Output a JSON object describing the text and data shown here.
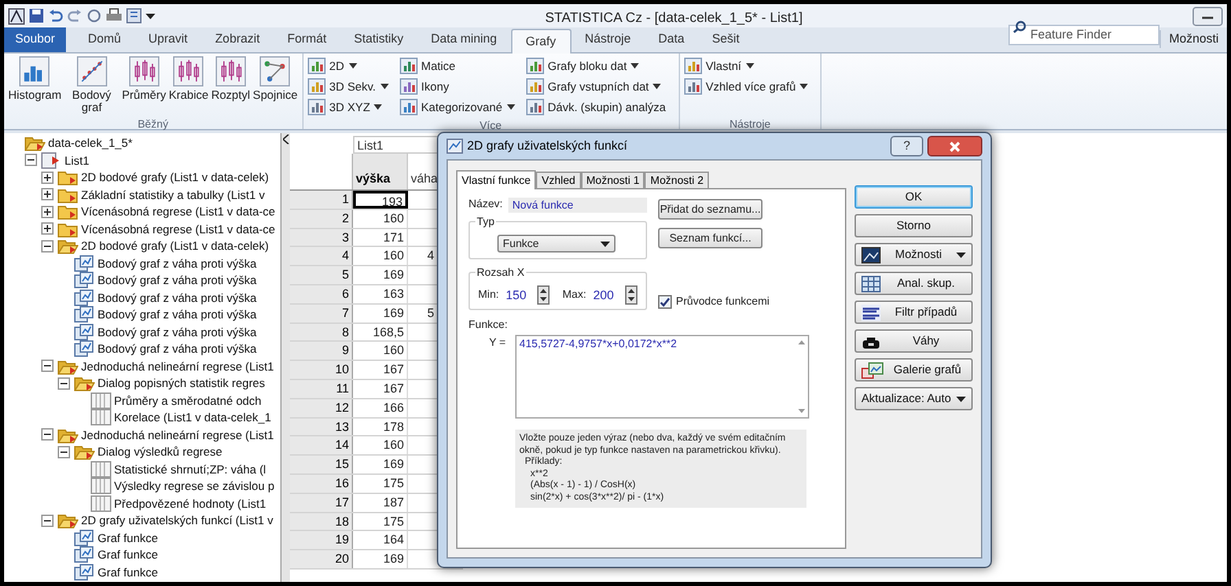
{
  "window": {
    "title": "STATISTICA Cz - [data-celek_1_5* - List1]"
  },
  "ribbon_tabs": [
    {
      "label": "Soubor",
      "kind": "file",
      "selected": false
    },
    {
      "label": "Domů",
      "kind": "tab",
      "selected": false
    },
    {
      "label": "Upravit",
      "kind": "tab",
      "selected": false
    },
    {
      "label": "Zobrazit",
      "kind": "tab",
      "selected": false
    },
    {
      "label": "Formát",
      "kind": "tab",
      "selected": false
    },
    {
      "label": "Statistiky",
      "kind": "tab",
      "selected": false
    },
    {
      "label": "Data mining",
      "kind": "tab",
      "selected": false
    },
    {
      "label": "Grafy",
      "kind": "tab",
      "selected": true
    },
    {
      "label": "Nástroje",
      "kind": "tab",
      "selected": false
    },
    {
      "label": "Data",
      "kind": "tab",
      "selected": false
    },
    {
      "label": "Sešit",
      "kind": "tab",
      "selected": false
    }
  ],
  "feature_finder": {
    "placeholder": "Feature Finder"
  },
  "options_label": "Možnosti",
  "ribbon_groups": [
    {
      "label": "Běžný",
      "kind": "large",
      "columns": [
        [
          {
            "label": "Histogram",
            "dropdown": false
          }
        ],
        [
          {
            "label": "Bodový graf",
            "dropdown": false
          }
        ],
        [
          {
            "label": "Průměry",
            "dropdown": false
          }
        ],
        [
          {
            "label": "Krabice",
            "dropdown": false
          }
        ],
        [
          {
            "label": "Rozptyl",
            "dropdown": false
          }
        ],
        [
          {
            "label": "Spojnice",
            "dropdown": false
          }
        ]
      ]
    },
    {
      "label": "Více",
      "kind": "small",
      "columns": [
        [
          {
            "label": "2D",
            "dropdown": true
          },
          {
            "label": "3D Sekv.",
            "dropdown": true
          },
          {
            "label": "3D XYZ",
            "dropdown": true
          }
        ],
        [
          {
            "label": "Matice",
            "dropdown": false
          },
          {
            "label": "Ikony",
            "dropdown": false
          },
          {
            "label": "Kategorizované",
            "dropdown": true
          }
        ],
        [
          {
            "label": "Grafy bloku dat",
            "dropdown": true
          },
          {
            "label": "Grafy vstupních dat",
            "dropdown": true
          },
          {
            "label": "Dávk. (skupin) analýza",
            "dropdown": false
          }
        ]
      ]
    },
    {
      "label": "Nástroje",
      "kind": "small",
      "columns": [
        [
          {
            "label": "Vlastní",
            "dropdown": true
          },
          {
            "label": "Vzhled více grafů",
            "dropdown": true
          }
        ]
      ]
    }
  ],
  "tree": [
    {
      "label": "data-celek_1_5*",
      "kind": "folder",
      "expanded": true,
      "children": [
        {
          "label": "List1",
          "kind": "sheet",
          "expanded": true,
          "children": [
            {
              "label": "2D bodové grafy (List1 v data-celek)",
              "kind": "folder",
              "expanded": false
            },
            {
              "label": "Základní statistiky a tabulky (List1 v",
              "kind": "folder",
              "expanded": false
            },
            {
              "label": "Vícenásobná regrese (List1 v data-ce",
              "kind": "folder",
              "expanded": false
            },
            {
              "label": "Vícenásobná regrese (List1 v data-ce",
              "kind": "folder",
              "expanded": false
            },
            {
              "label": "2D bodové grafy (List1 v data-celek)",
              "kind": "folder",
              "expanded": true,
              "children": [
                {
                  "label": "Bodový graf z váha proti výška",
                  "kind": "graph"
                },
                {
                  "label": "Bodový graf z váha proti výška",
                  "kind": "graph"
                },
                {
                  "label": "Bodový graf z váha proti výška",
                  "kind": "graph"
                },
                {
                  "label": "Bodový graf z váha proti výška",
                  "kind": "graph"
                },
                {
                  "label": "Bodový graf z váha proti výška",
                  "kind": "graph"
                },
                {
                  "label": "Bodový graf z váha proti výška",
                  "kind": "graph"
                }
              ]
            },
            {
              "label": "Jednoduchá nelineární regrese (List1",
              "kind": "folder",
              "expanded": true,
              "children": [
                {
                  "label": "Dialog popisných statistik regres",
                  "kind": "folder",
                  "expanded": true,
                  "children": [
                    {
                      "label": "Průměry a směrodatné odch",
                      "kind": "table"
                    },
                    {
                      "label": "Korelace (List1 v data-celek_1",
                      "kind": "table"
                    }
                  ]
                }
              ]
            },
            {
              "label": "Jednoduchá nelineární regrese (List1",
              "kind": "folder",
              "expanded": true,
              "children": [
                {
                  "label": "Dialog výsledků regrese",
                  "kind": "folder",
                  "expanded": true,
                  "children": [
                    {
                      "label": "Statistické shrnutí;ZP: váha (l",
                      "kind": "table"
                    },
                    {
                      "label": "Výsledky regrese se závislou p",
                      "kind": "table"
                    },
                    {
                      "label": "Předpovězené hodnoty (List1",
                      "kind": "table"
                    }
                  ]
                }
              ]
            },
            {
              "label": "2D grafy uživatelských funkcí (List1 v",
              "kind": "folder",
              "expanded": true,
              "children": [
                {
                  "label": "Graf funkce",
                  "kind": "graph"
                },
                {
                  "label": "Graf funkce",
                  "kind": "graph"
                },
                {
                  "label": "Graf funkce",
                  "kind": "graph"
                }
              ]
            }
          ]
        }
      ]
    }
  ],
  "sheet": {
    "title": "List1",
    "columns": [
      "výška",
      "váha"
    ],
    "rows": [
      {
        "header": "1",
        "cells": [
          "193",
          ""
        ],
        "selected": true
      },
      {
        "header": "2",
        "cells": [
          "160",
          ""
        ],
        "selected": false
      },
      {
        "header": "3",
        "cells": [
          "171",
          ""
        ],
        "selected": false
      },
      {
        "header": "4",
        "cells": [
          "160",
          "4"
        ],
        "selected": false
      },
      {
        "header": "5",
        "cells": [
          "169",
          ""
        ],
        "selected": false
      },
      {
        "header": "6",
        "cells": [
          "163",
          ""
        ],
        "selected": false
      },
      {
        "header": "7",
        "cells": [
          "169",
          "5"
        ],
        "selected": false
      },
      {
        "header": "8",
        "cells": [
          "168,5",
          ""
        ],
        "selected": false
      },
      {
        "header": "9",
        "cells": [
          "160",
          ""
        ],
        "selected": false
      },
      {
        "header": "10",
        "cells": [
          "167",
          ""
        ],
        "selected": false
      },
      {
        "header": "11",
        "cells": [
          "167",
          ""
        ],
        "selected": false
      },
      {
        "header": "12",
        "cells": [
          "166",
          ""
        ],
        "selected": false
      },
      {
        "header": "13",
        "cells": [
          "178",
          ""
        ],
        "selected": false
      },
      {
        "header": "14",
        "cells": [
          "160",
          ""
        ],
        "selected": false
      },
      {
        "header": "15",
        "cells": [
          "169",
          ""
        ],
        "selected": false
      },
      {
        "header": "16",
        "cells": [
          "175",
          ""
        ],
        "selected": false
      },
      {
        "header": "17",
        "cells": [
          "187",
          ""
        ],
        "selected": false
      },
      {
        "header": "18",
        "cells": [
          "175",
          ""
        ],
        "selected": false
      },
      {
        "header": "19",
        "cells": [
          "164",
          ""
        ],
        "selected": false
      },
      {
        "header": "20",
        "cells": [
          "169",
          ""
        ],
        "selected": false
      }
    ]
  },
  "dialog": {
    "title": "2D grafy uživatelských funkcí",
    "help_glyph": "?",
    "tabs": [
      {
        "label": "Vlastní funkce",
        "selected": true
      },
      {
        "label": "Vzhled",
        "selected": false
      },
      {
        "label": "Možnosti 1",
        "selected": false
      },
      {
        "label": "Možnosti 2",
        "selected": false
      }
    ],
    "name_label": "Název:",
    "name_value": "Nová funkce",
    "type_group": "Typ",
    "type_value": "Funkce",
    "range_group": "Rozsah X",
    "min_label": "Min:",
    "min_value": "150",
    "max_label": "Max:",
    "max_value": "200",
    "add_button": "Přidat do seznamu...",
    "list_button": "Seznam funkcí...",
    "wizard": {
      "label": "Průvodce funkcemi",
      "checked": true
    },
    "function_label": "Funkce:",
    "y_label": "Y =",
    "function_value": "415,5727-4,9757*x+0,0172*x**2",
    "help": {
      "text": "Vložte pouze jeden výraz (nebo dva, každý ve svém editačním okně, pokud je typ funkce nastaven na parametrickou křivku).",
      "examples_label": "Příklady:",
      "examples": [
        "x**2",
        "(Abs(x - 1) - 1) / CosH(x)",
        "sin(2*x) + cos(3*x**2)/ pi - (1*x)"
      ]
    },
    "buttons": [
      {
        "label": "OK",
        "kind": "default"
      },
      {
        "label": "Storno",
        "kind": "plain"
      },
      {
        "label": "Možnosti",
        "kind": "options"
      },
      {
        "label": "Anal. skup.",
        "kind": "groups"
      },
      {
        "label": "Filtr případů",
        "kind": "filter"
      },
      {
        "label": "Váhy",
        "kind": "weights"
      },
      {
        "label": "Galerie grafů",
        "kind": "gallery"
      },
      {
        "label": "Aktualizace: Auto",
        "kind": "dropdown"
      }
    ]
  }
}
